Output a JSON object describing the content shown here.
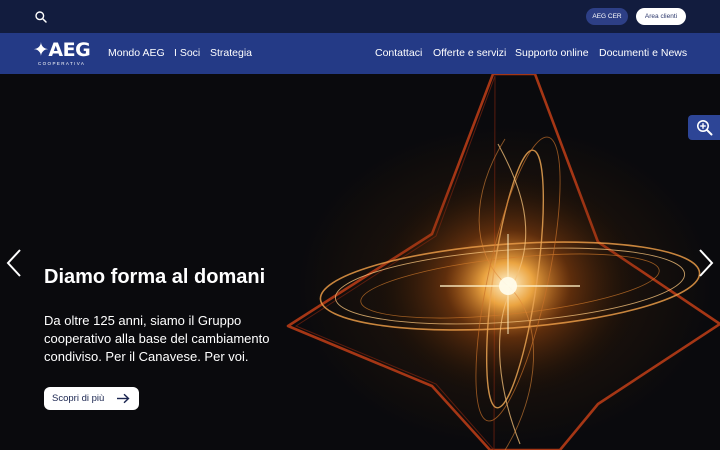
{
  "topbar": {
    "search_icon": "search-icon",
    "cer_label": "AEG CER",
    "area_label": "Area clienti"
  },
  "navbar": {
    "logo_text": "AEG",
    "logo_sub": "COOPERATIVA",
    "left_items": [
      "Mondo AEG",
      "I Soci",
      "Strategia"
    ],
    "right_items": [
      "Contattaci",
      "Offerte e servizi",
      "Supporto online",
      "Documenti e News"
    ]
  },
  "hero": {
    "title": "Diamo forma al domani",
    "text": "Da oltre 125 anni, siamo il Gruppo cooperativo alla base del cambiamento condiviso. Per il Canavese. Per voi.",
    "cta_label": "Scopri di più",
    "cta_icon": "arrow-right-icon",
    "prev_icon": "chevron-left-icon",
    "next_icon": "chevron-right-icon"
  },
  "accessibility": {
    "icon": "zoom-in-icon"
  },
  "colors": {
    "topbar_bg": "#121c3e",
    "navbar_bg": "#243a86",
    "cer_button_bg": "#2d3f86",
    "accent_orange": "#d9531f"
  }
}
